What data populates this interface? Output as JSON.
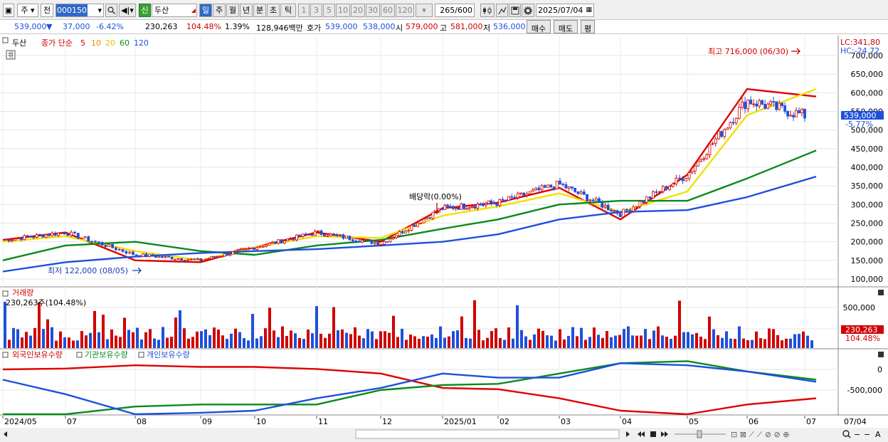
{
  "toolbar": {
    "mode_ju": "주",
    "mode_jeon": "전",
    "code": "000150",
    "stock_name": "두산",
    "sin": "신",
    "periods": [
      "일",
      "주",
      "월",
      "년",
      "분",
      "초",
      "틱"
    ],
    "numbers": [
      "1",
      "3",
      "5",
      "10",
      "20",
      "30",
      "60",
      "120"
    ],
    "count": "265",
    "count_max": "/600",
    "date": "2025/07/04"
  },
  "quote": {
    "price": "539,000",
    "arrow": "▼",
    "change": "37,000",
    "change_pct": "-6.42%",
    "volume": "230,263",
    "vol_ratio": "104.48%",
    "turnover": "1.39%",
    "trade_amount": "128,946백만",
    "hoga_label": "호가",
    "ask": "539,000",
    "bid": "538,000",
    "open_label": "시",
    "open": "579,000",
    "high_label": "고",
    "high": "581,000",
    "low_label": "저",
    "low": "536,000",
    "buy_btn": "매수",
    "sell_btn": "매도",
    "extra_btn": "평"
  },
  "price_panel": {
    "title": "두산",
    "legend_label": "종가 단순",
    "ma": [
      {
        "period": "5",
        "color": "#e00000"
      },
      {
        "period": "10",
        "color": "#f08c00"
      },
      {
        "period": "20",
        "color": "#f0e000"
      },
      {
        "period": "60",
        "color": "#0a8a1e"
      },
      {
        "period": "120",
        "color": "#1e50dc"
      }
    ],
    "lc": "LC:341,80",
    "hc": "HC:-24.72",
    "current_tag": "539,000",
    "current_pct": "-5.77%",
    "annot_high": "최고 716,000 (06/30)",
    "annot_low": "최저 122,000 (08/05)",
    "annot_div": "배당락(0.00%)",
    "yticks": [
      "700,000",
      "650,000",
      "600,000",
      "550,000",
      "500,000",
      "450,000",
      "400,000",
      "350,000",
      "300,000",
      "250,000",
      "200,000",
      "150,000",
      "100,000"
    ]
  },
  "volume_panel": {
    "title": "거래량",
    "value_text": "230,263주(104.48%)",
    "yticks": [
      "500,000",
      "0"
    ],
    "current_tag": "230,263",
    "current_pct": "104.48%"
  },
  "holding_panel": {
    "legend": [
      "외국인보유수량",
      "기관보유수량",
      "개인보유수량"
    ],
    "legend_colors": [
      "#e00000",
      "#0a8a1e",
      "#1e50dc"
    ],
    "yticks": [
      "0",
      "-500,000"
    ]
  },
  "xaxis": {
    "labels": [
      "2024/05",
      "07",
      "08",
      "09",
      "10",
      "11",
      "12",
      "2025/01",
      "02",
      "03",
      "04",
      "05",
      "06",
      "07"
    ],
    "right_label": "07/04"
  },
  "chart_data": {
    "type": "candlestick",
    "title": "두산",
    "ylim": [
      100000,
      730000
    ],
    "extremes": {
      "high": 716000,
      "high_date": "06/30",
      "low": 122000,
      "low_date": "08/05"
    },
    "close_by_month": {
      "x": [
        "2024/05",
        "07",
        "08",
        "09",
        "10",
        "11",
        "12",
        "2025/01",
        "02",
        "03",
        "04",
        "05",
        "06",
        "07"
      ],
      "values": [
        205000,
        225000,
        165000,
        150000,
        185000,
        225000,
        195000,
        290000,
        305000,
        355000,
        275000,
        380000,
        580000,
        539000
      ]
    },
    "series": [
      {
        "name": "5",
        "x": [
          "2024/05",
          "07",
          "08",
          "09",
          "10",
          "11",
          "12",
          "2025/01",
          "02",
          "03",
          "04",
          "05",
          "06",
          "07"
        ],
        "values": [
          205000,
          225000,
          150000,
          145000,
          185000,
          225000,
          200000,
          290000,
          305000,
          345000,
          260000,
          380000,
          610000,
          590000
        ]
      },
      {
        "name": "20",
        "x": [
          "2024/05",
          "07",
          "08",
          "09",
          "10",
          "11",
          "12",
          "2025/01",
          "02",
          "03",
          "04",
          "05",
          "06",
          "07"
        ],
        "values": [
          200000,
          215000,
          175000,
          150000,
          185000,
          215000,
          210000,
          270000,
          295000,
          330000,
          280000,
          335000,
          540000,
          610000
        ]
      },
      {
        "name": "60",
        "x": [
          "2024/05",
          "07",
          "08",
          "09",
          "10",
          "11",
          "12",
          "2025/01",
          "02",
          "03",
          "04",
          "05",
          "06",
          "07"
        ],
        "values": [
          150000,
          190000,
          200000,
          175000,
          165000,
          190000,
          205000,
          235000,
          260000,
          300000,
          310000,
          310000,
          370000,
          445000
        ]
      },
      {
        "name": "120",
        "x": [
          "2024/05",
          "07",
          "08",
          "09",
          "10",
          "11",
          "12",
          "2025/01",
          "02",
          "03",
          "04",
          "05",
          "06",
          "07"
        ],
        "values": [
          120000,
          145000,
          160000,
          170000,
          175000,
          180000,
          190000,
          200000,
          220000,
          260000,
          280000,
          285000,
          320000,
          375000
        ]
      }
    ],
    "volume": {
      "last": 230263
    },
    "holdings": {
      "x": [
        "2024/05",
        "07",
        "08",
        "09",
        "10",
        "11",
        "12",
        "2025/01",
        "02",
        "03",
        "04",
        "05",
        "06",
        "07"
      ],
      "foreign": [
        0,
        20000,
        100000,
        60000,
        60000,
        10000,
        -100000,
        -450000,
        -480000,
        -700000,
        -1000000,
        -1100000,
        -850000,
        -700000
      ],
      "institution": [
        -1150000,
        -1100000,
        -900000,
        -850000,
        -850000,
        -850000,
        -500000,
        -380000,
        -350000,
        -100000,
        150000,
        200000,
        -50000,
        -250000
      ],
      "individual": [
        -250000,
        -600000,
        -1100000,
        -1050000,
        -1000000,
        -700000,
        -450000,
        -100000,
        -200000,
        -200000,
        150000,
        100000,
        -50000,
        -300000
      ]
    }
  }
}
